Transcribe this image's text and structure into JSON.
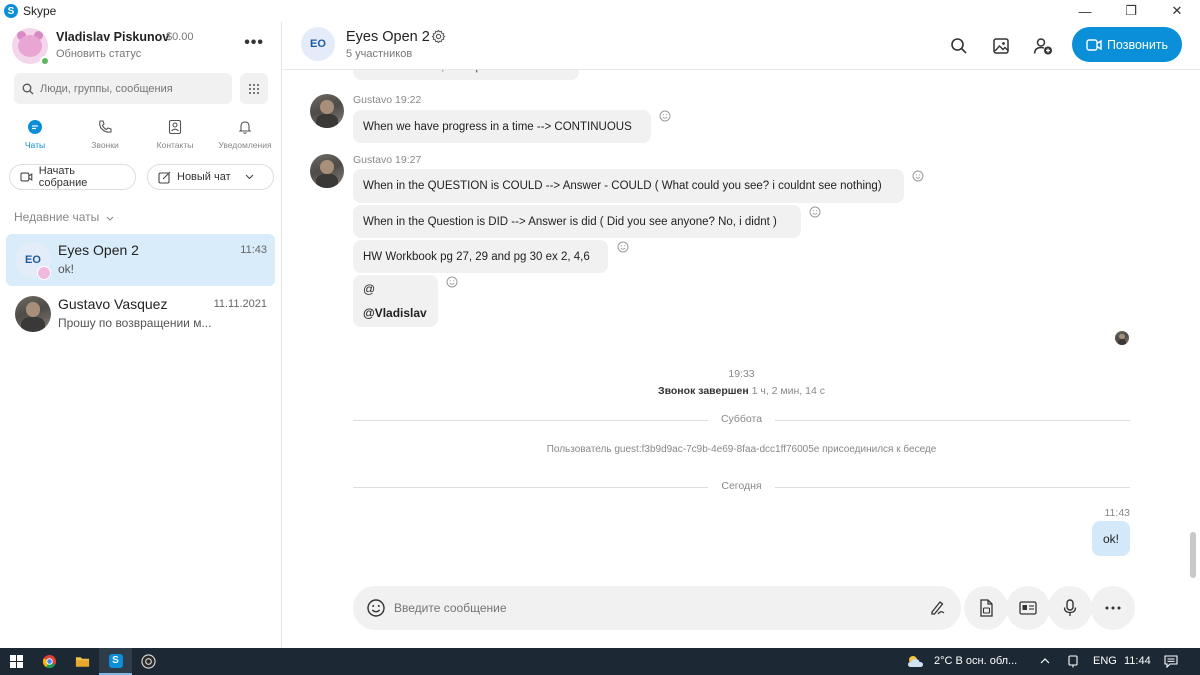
{
  "window": {
    "app_name": "Skype",
    "controls": {
      "minimize": "—",
      "restore": "❐",
      "close": "✕"
    }
  },
  "profile": {
    "name": "Vladislav Piskunov",
    "balance": "$0.00",
    "status": "Обновить статус",
    "more": "•••"
  },
  "search": {
    "placeholder": "Люди, группы, сообщения"
  },
  "nav_tabs": [
    {
      "label": "Чаты",
      "icon": "chat-icon",
      "active": true
    },
    {
      "label": "Звонки",
      "icon": "phone-icon"
    },
    {
      "label": "Контакты",
      "icon": "contacts-icon"
    },
    {
      "label": "Уведомления",
      "icon": "bell-icon"
    }
  ],
  "actions": {
    "meet_now": "Начать собрание",
    "new_chat": "Новый чат"
  },
  "recent_chats_label": "Недавние чаты",
  "chats": [
    {
      "avatar_initials": "EO",
      "name": "Eyes Open 2",
      "time": "11:43",
      "preview": "ok!",
      "active": true
    },
    {
      "name": "Gustavo Vasquez",
      "time": "11.11.2021",
      "preview": "Прошу по возвращении м..."
    }
  ],
  "conversation": {
    "avatar_initials": "EO",
    "title": "Eyes Open 2",
    "participants": "5 участников",
    "call_button": "Позвонить",
    "partial_message": "Past continuous, while past continuous",
    "messages": [
      {
        "sender": "Gustavo",
        "time": "19:22",
        "text": "When we have progress in a time  --> CONTINUOUS"
      },
      {
        "sender": "Gustavo",
        "time": "19:27",
        "text": "When in the QUESTION is  COULD --> Answer - COULD ( What could you see? i couldnt see nothing)"
      },
      {
        "text": "When in the Question is DID --> Answer is did ( Did you see anyone? No, i didnt )"
      },
      {
        "text": "HW Workbook  pg 27, 29 and pg 30 ex 2, 4,6"
      },
      {
        "mention_at": "@",
        "mention_name": "@Vladislav"
      }
    ],
    "call_time": "19:33",
    "call_ended_label": "Звонок завершен",
    "call_duration": "1 ч, 2 мин, 14 с",
    "divider_saturday": "Суббота",
    "join_notice": "Пользователь guest:f3b9d9ac-7c9b-4e69-8faa-dcc1ff76005e присоединился к беседе",
    "divider_today": "Сегодня",
    "my_message": {
      "time": "11:43",
      "text": "ok!"
    },
    "composer_placeholder": "Введите сообщение"
  },
  "taskbar": {
    "weather": "2°C  В осн. обл...",
    "language": "ENG",
    "clock": "11:44"
  },
  "colors": {
    "accent": "#0a8fd8",
    "active_chat_bg": "#d9ecf9",
    "my_bubble": "#d3e8f8",
    "taskbar": "#1c2834"
  }
}
